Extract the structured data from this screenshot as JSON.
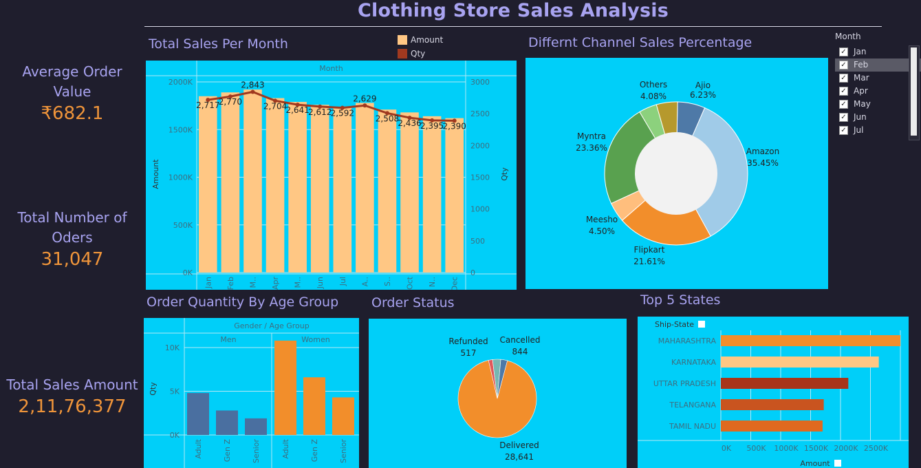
{
  "title": "Clothing Store Sales Analysis",
  "kpis": {
    "aov_label": "Average Order Value",
    "aov_value": "₹682.1",
    "orders_label": "Total Number of Oders",
    "orders_value": "31,047",
    "sales_label": "Total Sales Amount",
    "sales_value": "2,11,76,377"
  },
  "sections": {
    "monthly": "Total Sales Per Month",
    "channel": "Differnt Channel Sales Percentage",
    "age": "Order Quantity By Age Group",
    "status": "Order Status",
    "states": "Top 5 States"
  },
  "filter": {
    "title": "Month",
    "items": [
      {
        "label": "Jan",
        "checked": true
      },
      {
        "label": "Feb",
        "checked": true
      },
      {
        "label": "Mar",
        "checked": true
      },
      {
        "label": "Apr",
        "checked": true
      },
      {
        "label": "May",
        "checked": true
      },
      {
        "label": "Jun",
        "checked": true
      },
      {
        "label": "Jul",
        "checked": true
      }
    ],
    "selected_index": 1
  },
  "colors": {
    "panel": "#00cff9",
    "amount": "#ffc784",
    "qty": "#a0391f",
    "men": "#4a6fa0",
    "women": "#f28e2b",
    "title": "#a8a3f0",
    "kpi_value": "#f0953a"
  },
  "chart_data": [
    {
      "id": "monthly",
      "type": "bar",
      "header": "Month",
      "categories": [
        "Jan",
        "Feb",
        "M..",
        "Apr",
        "M..",
        "Jun",
        "Jul",
        "A..",
        "S..",
        "Oct",
        "N..",
        "Dec"
      ],
      "ylabel": "Amount",
      "y2label": "Qty",
      "ylim": [
        0,
        2000000
      ],
      "y2lim": [
        0,
        3000
      ],
      "yticks": [
        "0K",
        "500K",
        "1000K",
        "1500K",
        "2000K"
      ],
      "y2ticks": [
        "0",
        "500",
        "1000",
        "1500",
        "2000",
        "2500",
        "3000"
      ],
      "legend": [
        "Amount",
        "Qty"
      ],
      "series": [
        {
          "name": "Amount",
          "type": "bar",
          "values": [
            1850000,
            1890000,
            1920000,
            1830000,
            1790000,
            1760000,
            1740000,
            1780000,
            1710000,
            1680000,
            1640000,
            1620000
          ]
        },
        {
          "name": "Qty",
          "type": "line",
          "values": [
            2717,
            2770,
            2843,
            2704,
            2641,
            2612,
            2592,
            2629,
            2508,
            2436,
            2395,
            2390
          ]
        }
      ],
      "qty_labels": [
        "2,717",
        "2,770",
        "2,843",
        "2,704",
        "2,641",
        "2,612",
        "2,592",
        "2,629",
        "2,508",
        "2,436",
        "2,395",
        "2,390"
      ]
    },
    {
      "id": "channel",
      "type": "pie",
      "donut": true,
      "slices": [
        {
          "label": "Ajio",
          "pct": 6.23,
          "pct_text": "6.23%",
          "color": "#4e79a7"
        },
        {
          "label": "Amazon",
          "pct": 35.45,
          "pct_text": "35.45%",
          "color": "#a0cbe8"
        },
        {
          "label": "Flipkart",
          "pct": 21.61,
          "pct_text": "21.61%",
          "color": "#f28e2b"
        },
        {
          "label": "Meesho",
          "pct": 4.5,
          "pct_text": "4.50%",
          "color": "#ffbe7d"
        },
        {
          "label": "Myntra",
          "pct": 23.36,
          "pct_text": "23.36%",
          "color": "#59a14f"
        },
        {
          "label": "Others",
          "pct": 4.08,
          "pct_text": "4.08%",
          "color": "#8cd17d"
        },
        {
          "label": "",
          "pct": 4.77,
          "pct_text": "",
          "color": "#b6992d"
        }
      ]
    },
    {
      "id": "age",
      "type": "bar",
      "header": "Gender / Age Group",
      "groups": [
        "Men",
        "Women"
      ],
      "categories": [
        "Adult",
        "Gen Z",
        "Senior"
      ],
      "ylabel": "Qty",
      "ylim": [
        0,
        11500
      ],
      "yticks": [
        "0K",
        "5K",
        "10K"
      ],
      "series": [
        {
          "name": "Men",
          "values": [
            4800,
            2800,
            1900
          ]
        },
        {
          "name": "Women",
          "values": [
            10800,
            6600,
            4300
          ]
        }
      ]
    },
    {
      "id": "status",
      "type": "pie",
      "slices": [
        {
          "label": "Delivered",
          "value": 28641,
          "value_text": "28,641",
          "color": "#f28e2b"
        },
        {
          "label": "Refunded",
          "value": 517,
          "value_text": "517",
          "color": "#e15759"
        },
        {
          "label": "",
          "value": 1045,
          "value_text": "",
          "color": "#76b7b2"
        },
        {
          "label": "Cancelled",
          "value": 844,
          "value_text": "844",
          "color": "#4e79a7"
        }
      ]
    },
    {
      "id": "states",
      "type": "bar",
      "orientation": "horizontal",
      "header": "Ship-State",
      "categories": [
        "MAHARASHTRA",
        "KARNATAKA",
        "UTTAR PRADESH",
        "TELANGANA",
        "TAMIL NADU"
      ],
      "values": [
        3000000,
        2640000,
        2130000,
        1720000,
        1700000
      ],
      "colors": [
        "#f28e2b",
        "#ffc784",
        "#a8341a",
        "#c9541f",
        "#e0691f"
      ],
      "xlabel": "Amount",
      "xlim": [
        0,
        3000000
      ],
      "xticks": [
        "0K",
        "500K",
        "1000K",
        "1500K",
        "2000K",
        "2500K"
      ]
    }
  ]
}
